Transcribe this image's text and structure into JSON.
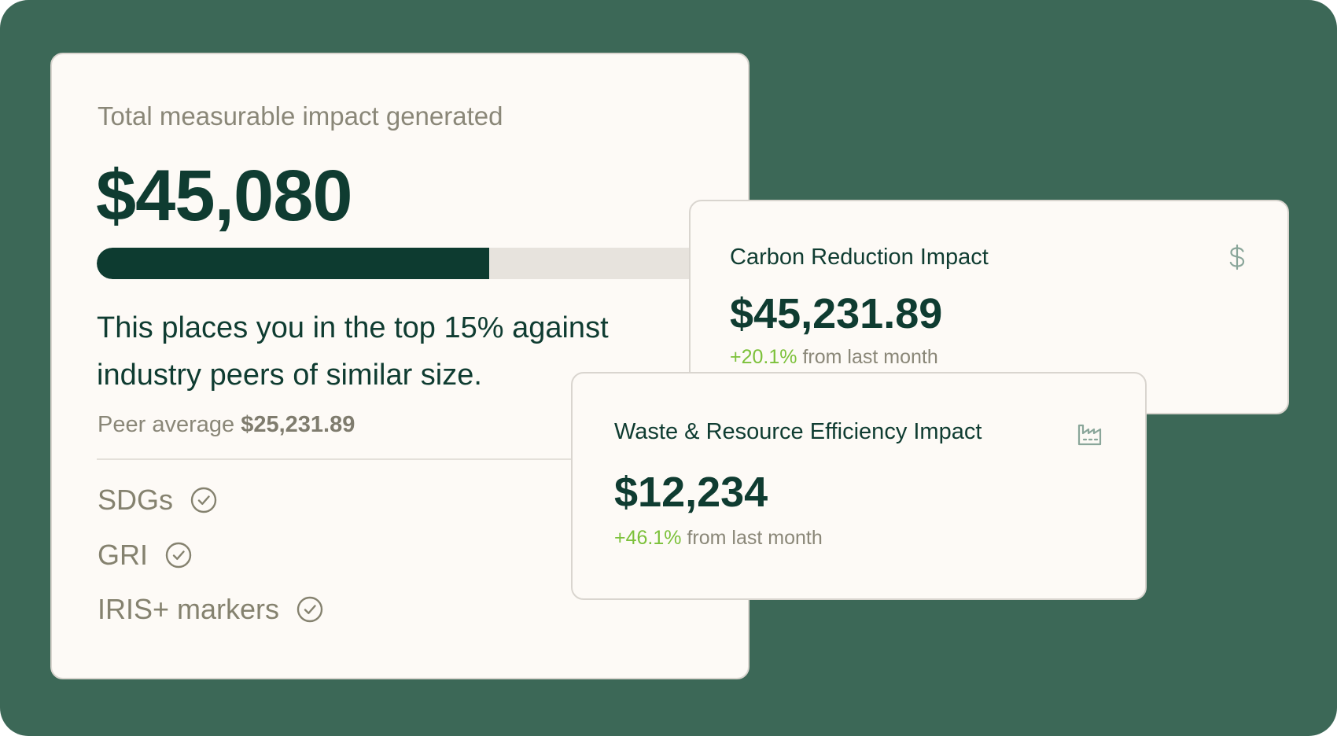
{
  "main_card": {
    "label": "Total measurable impact generated",
    "value": "$45,080",
    "progress_fraction": 0.6,
    "description": "This places you in the top 15% against industry peers of similar size.",
    "peer_label": "Peer average",
    "peer_value": "$25,231.89",
    "frameworks": [
      {
        "label": "SDGs",
        "icon": "check-circle-icon"
      },
      {
        "label": "GRI",
        "icon": "check-circle-icon"
      },
      {
        "label": "IRIS+ markers",
        "icon": "check-circle-icon"
      }
    ]
  },
  "carbon_card": {
    "title": "Carbon Reduction Impact",
    "value": "$45,231.89",
    "change_pct": "+20.1%",
    "change_suffix": "from last month",
    "icon": "dollar-icon"
  },
  "waste_card": {
    "title": "Waste & Resource Efficiency Impact",
    "value": "$12,234",
    "change_pct": "+46.1%",
    "change_suffix": "from last month",
    "icon": "factory-icon"
  },
  "colors": {
    "background": "#3c6857",
    "card": "#fdfaf6",
    "primary_text": "#0f3c31",
    "muted_text": "#8a8778",
    "positive": "#7cc13a",
    "progress_fill": "#0d3b30",
    "progress_track": "#e7e3dd"
  }
}
